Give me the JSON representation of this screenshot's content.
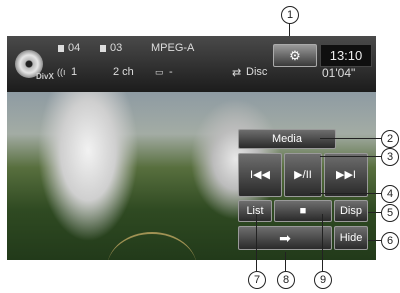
{
  "status_bar": {
    "folder_number": "04",
    "file_number": "03",
    "format": "MPEG-A",
    "audio_channel": "1",
    "channels": "2 ch",
    "subtitle_indicator": "-",
    "repeat_mode": "Disc",
    "clock": "13:10",
    "elapsed_time": "01'04\"",
    "disc_icon": "disc-icon",
    "divx_label": "DivX"
  },
  "buttons": {
    "media": "Media",
    "prev": "I◀◀",
    "play_pause": "▶/II",
    "next": "▶▶I",
    "list": "List",
    "stop": "■",
    "disp": "Disp",
    "skip": "➡",
    "hide": "Hide"
  },
  "callouts": {
    "c1": "1",
    "c2": "2",
    "c3": "3",
    "c4": "4",
    "c5": "5",
    "c6": "6",
    "c7": "7",
    "c8": "8",
    "c9": "9"
  }
}
